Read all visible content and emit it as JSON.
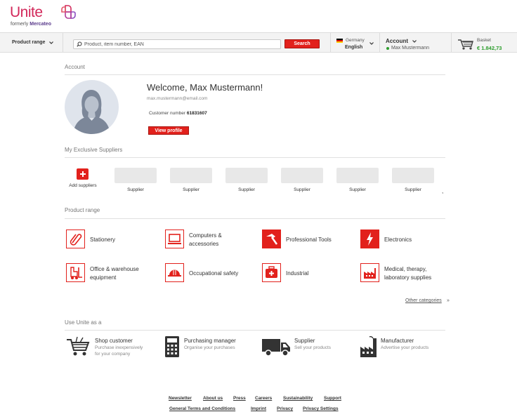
{
  "header": {
    "logo_text": "Unite",
    "logo_sub_prefix": "formerly",
    "logo_sub_brand": "Mercateo",
    "product_range_label": "Product range",
    "search_placeholder": "Product, item number, EAN",
    "search_button": "Search",
    "country": "Germany",
    "language": "English",
    "account_label": "Account",
    "account_user": "Max Mustermann",
    "basket_label": "Basket",
    "basket_total": "€ 1.842,73"
  },
  "colors": {
    "brand": "#e2211c",
    "logo": "#d2285a",
    "online": "#2e9e2e"
  },
  "account": {
    "section_title": "Account",
    "welcome": "Welcome, Max Mustermann!",
    "email": "max.mustermann@email.com",
    "customer_number_label": "Customer number",
    "customer_number": "61831607",
    "view_profile": "View profile"
  },
  "suppliers": {
    "section_title": "My Exclusive Suppliers",
    "add_label": "Add suppliers",
    "items": [
      {
        "label": "Supplier"
      },
      {
        "label": "Supplier"
      },
      {
        "label": "Supplier"
      },
      {
        "label": "Supplier"
      },
      {
        "label": "Supplier"
      },
      {
        "label": "Supplier"
      }
    ],
    "more": ","
  },
  "product_range": {
    "section_title": "Product range",
    "categories": [
      {
        "label": "Stationery",
        "icon": "paperclip-icon"
      },
      {
        "label": "Computers &",
        "label2": "accessories",
        "icon": "laptop-icon"
      },
      {
        "label": "Professional Tools",
        "icon": "hammer-icon"
      },
      {
        "label": "Electronics",
        "icon": "lightning-icon"
      },
      {
        "label": "Office & warehouse",
        "label2": "equipment",
        "icon": "forklift-icon"
      },
      {
        "label": "Occupational safety",
        "icon": "hardhat-icon"
      },
      {
        "label": "Industrial",
        "icon": "first-aid-icon"
      },
      {
        "label": "Medical, therapy,",
        "label2": "laboratory supplies",
        "icon": "factory-icon"
      }
    ],
    "other_categories": "Other categories",
    "other_arrow": "»"
  },
  "use_as": {
    "section_title": "Use Unite as a",
    "roles": [
      {
        "title": "Shop customer",
        "desc1": "Purchase inexpensively",
        "desc2": "for your company",
        "icon": "shopping-cart-icon"
      },
      {
        "title": "Purchasing manager",
        "desc1": "Organise your purchases",
        "desc2": "",
        "icon": "calculator-icon"
      },
      {
        "title": "Supplier",
        "desc1": "Sell your products",
        "desc2": "",
        "icon": "truck-icon"
      },
      {
        "title": "Manufacturer",
        "desc1": "Advertise your products",
        "desc2": "",
        "icon": "factory-icon"
      }
    ]
  },
  "footer": {
    "row1": [
      "Newsletter",
      "About us",
      "Press",
      "Careers",
      "Sustainability",
      "Support"
    ],
    "row2": [
      "General Terms and Conditions",
      "Imprint",
      "Privacy",
      "Privacy Settings"
    ]
  }
}
